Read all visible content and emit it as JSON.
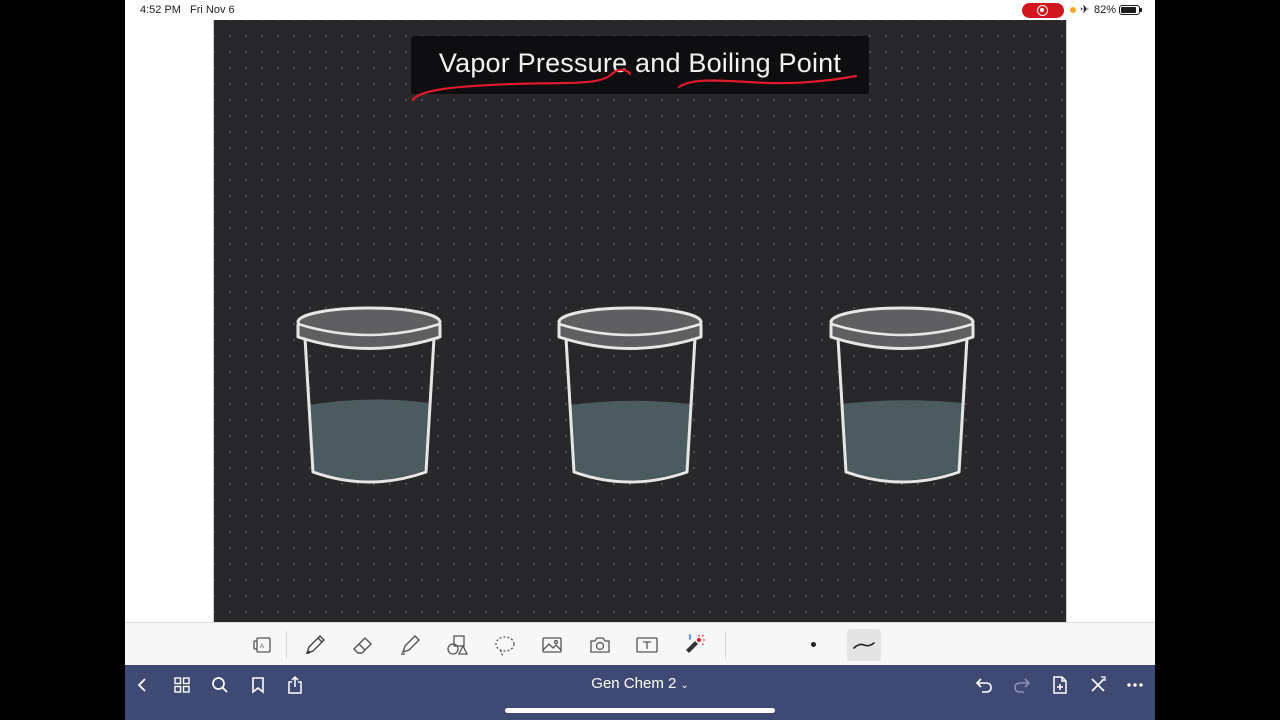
{
  "status_bar": {
    "time": "4:52 PM",
    "date": "Fri Nov 6",
    "battery_percent": "82%",
    "battery_level": 0.82,
    "recording": true,
    "icons": [
      "screen-record-icon",
      "airplane-mode-icon",
      "battery-icon"
    ]
  },
  "page": {
    "title": "Vapor Pressure and Boiling Point",
    "background_color": "#28282b",
    "underline_color": "#e0192d",
    "beakers": [
      {
        "liquid_color": "#4c5b5f"
      },
      {
        "liquid_color": "#4c5b5f"
      },
      {
        "liquid_color": "#4c5b5f"
      }
    ]
  },
  "toolbar": {
    "tools": [
      {
        "name": "view-mode-icon"
      },
      {
        "name": "pen-tool-icon",
        "selected": true
      },
      {
        "name": "eraser-tool-icon"
      },
      {
        "name": "highlighter-tool-icon"
      },
      {
        "name": "shapes-tool-icon"
      },
      {
        "name": "lasso-tool-icon"
      },
      {
        "name": "image-tool-icon"
      },
      {
        "name": "camera-tool-icon"
      },
      {
        "name": "text-tool-icon"
      },
      {
        "name": "laser-pointer-icon"
      }
    ]
  },
  "nav_bar": {
    "document_title": "Gen Chem 2",
    "background_color": "#3e4a73",
    "icons": [
      "back-icon",
      "thumbnails-icon",
      "search-icon",
      "bookmark-icon",
      "share-icon",
      "undo-icon",
      "redo-icon",
      "add-page-icon",
      "close-icon",
      "more-icon"
    ]
  }
}
